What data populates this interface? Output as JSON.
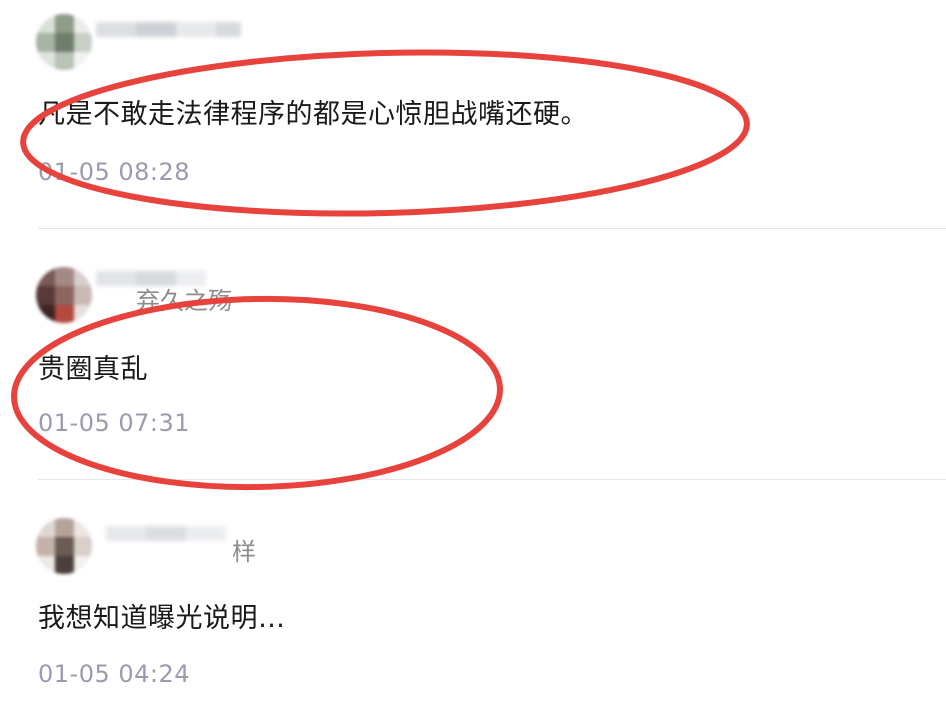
{
  "comments": [
    {
      "username": "",
      "text": "凡是不敢走法律程序的都是心惊胆战嘴还硬。",
      "time": "01-05 08:28"
    },
    {
      "username": "弃久之殇",
      "text": "贵圈真乱",
      "time": "01-05 07:31"
    },
    {
      "username": "样",
      "text": "我想知道曝光说明…",
      "time": "01-05 04:24"
    }
  ],
  "colors": {
    "annotation_red": "#e8423c",
    "timestamp": "#9b9bb0",
    "text": "#1a1a1a"
  }
}
